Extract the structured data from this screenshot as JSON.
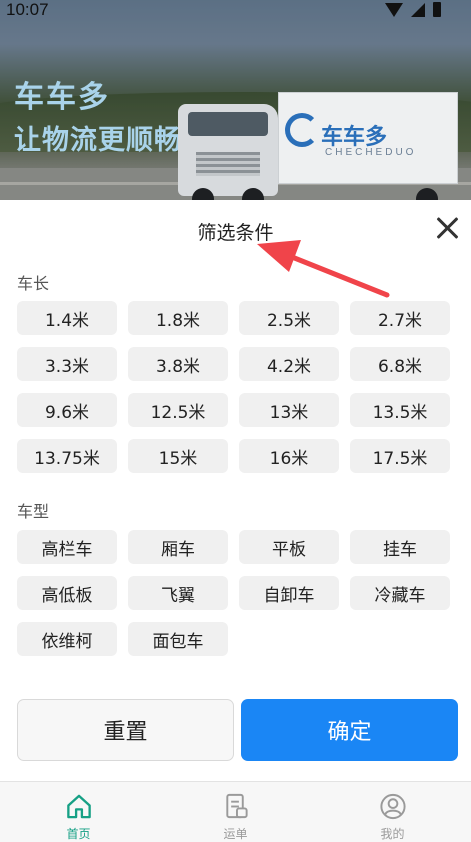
{
  "status_bar": {
    "time": "10:07"
  },
  "banner": {
    "slogan_line1": "车车多",
    "slogan_line2": "让物流更顺畅",
    "truck_brand": "车车多",
    "truck_brand_sub": "CHECHEDUO"
  },
  "filter_sheet": {
    "title": "筛选条件",
    "length_section": {
      "title": "车长",
      "options": [
        "1.4米",
        "1.8米",
        "2.5米",
        "2.7米",
        "3.3米",
        "3.8米",
        "4.2米",
        "6.8米",
        "9.6米",
        "12.5米",
        "13米",
        "13.5米",
        "13.75米",
        "15米",
        "16米",
        "17.5米"
      ]
    },
    "type_section": {
      "title": "车型",
      "options": [
        "高栏车",
        "厢车",
        "平板",
        "挂车",
        "高低板",
        "飞翼",
        "自卸车",
        "冷藏车",
        "依维柯",
        "面包车"
      ]
    },
    "reset_label": "重置",
    "confirm_label": "确定"
  },
  "bottom_nav": {
    "items": [
      {
        "label": "首页",
        "icon": "home-icon",
        "active": true
      },
      {
        "label": "运单",
        "icon": "waybill-icon",
        "active": false
      },
      {
        "label": "我的",
        "icon": "profile-icon",
        "active": false
      }
    ]
  },
  "colors": {
    "accent": "#1a86f5",
    "nav_active": "#16a085",
    "chip_bg": "#f0f0f0",
    "annotation_arrow": "#f0444a"
  }
}
